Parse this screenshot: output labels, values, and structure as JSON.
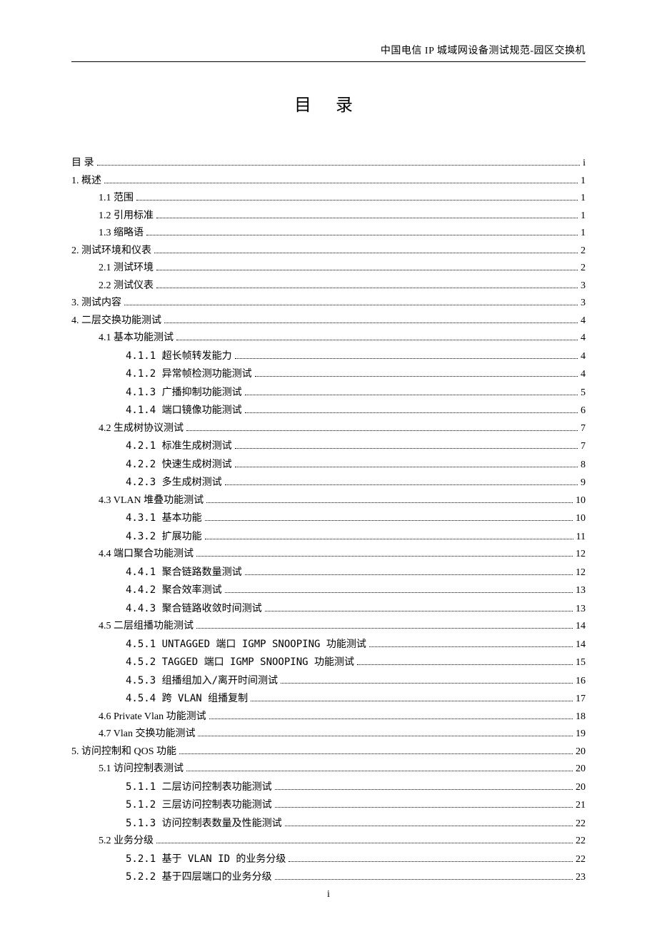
{
  "header": "中国电信 IP 城域网设备测试规范-园区交换机",
  "title": "目  录",
  "footer_page": "i",
  "toc": [
    {
      "level": 0,
      "label": "目   录",
      "page": "i"
    },
    {
      "level": 0,
      "label": "1. 概述",
      "page": "1"
    },
    {
      "level": 1,
      "label": "1.1 范围",
      "page": "1"
    },
    {
      "level": 1,
      "label": "1.2 引用标准",
      "page": "1"
    },
    {
      "level": 1,
      "label": "1.3 缩略语",
      "page": "1"
    },
    {
      "level": 0,
      "label": "2. 测试环境和仪表",
      "page": "2"
    },
    {
      "level": 1,
      "label": "2.1 测试环境",
      "page": "2"
    },
    {
      "level": 1,
      "label": "2.2 测试仪表",
      "page": "3"
    },
    {
      "level": 0,
      "label": "3. 测试内容",
      "page": "3"
    },
    {
      "level": 0,
      "label": "4. 二层交换功能测试",
      "page": "4"
    },
    {
      "level": 1,
      "label": "4.1 基本功能测试",
      "page": "4"
    },
    {
      "level": 2,
      "label": "4.1.1 超长帧转发能力",
      "page": "4"
    },
    {
      "level": 2,
      "label": "4.1.2 异常帧检测功能测试",
      "page": "4"
    },
    {
      "level": 2,
      "label": "4.1.3 广播抑制功能测试",
      "page": "5"
    },
    {
      "level": 2,
      "label": "4.1.4 端口镜像功能测试",
      "page": "6"
    },
    {
      "level": 1,
      "label": "4.2 生成树协议测试",
      "page": "7"
    },
    {
      "level": 2,
      "label": "4.2.1 标准生成树测试",
      "page": "7"
    },
    {
      "level": 2,
      "label": "4.2.2 快速生成树测试",
      "page": "8"
    },
    {
      "level": 2,
      "label": "4.2.3 多生成树测试",
      "page": "9"
    },
    {
      "level": 1,
      "label": "4.3 VLAN 堆叠功能测试",
      "page": "10"
    },
    {
      "level": 2,
      "label": "4.3.1 基本功能",
      "page": "10"
    },
    {
      "level": 2,
      "label": "4.3.2 扩展功能",
      "page": "11"
    },
    {
      "level": 1,
      "label": "4.4 端口聚合功能测试",
      "page": "12"
    },
    {
      "level": 2,
      "label": "4.4.1 聚合链路数量测试",
      "page": "12"
    },
    {
      "level": 2,
      "label": "4.4.2 聚合效率测试",
      "page": "13"
    },
    {
      "level": 2,
      "label": "4.4.3 聚合链路收敛时间测试",
      "page": "13"
    },
    {
      "level": 1,
      "label": "4.5 二层组播功能测试",
      "page": "14"
    },
    {
      "level": 2,
      "label": "4.5.1 UNTAGGED 端口 IGMP SNOOPING 功能测试",
      "page": "14"
    },
    {
      "level": 2,
      "label": "4.5.2 TAGGED 端口 IGMP SNOOPING 功能测试",
      "page": "15"
    },
    {
      "level": 2,
      "label": "4.5.3 组播组加入/离开时间测试",
      "page": "16"
    },
    {
      "level": 2,
      "label": "4.5.4 跨 VLAN 组播复制",
      "page": "17"
    },
    {
      "level": 1,
      "label": "4.6 Private Vlan 功能测试",
      "page": "18"
    },
    {
      "level": 1,
      "label": "4.7 Vlan 交换功能测试",
      "page": "19"
    },
    {
      "level": 0,
      "label": "5. 访问控制和 QOS 功能",
      "page": "20"
    },
    {
      "level": 1,
      "label": "5.1 访问控制表测试",
      "page": "20"
    },
    {
      "level": 2,
      "label": "5.1.1 二层访问控制表功能测试",
      "page": "20"
    },
    {
      "level": 2,
      "label": "5.1.2 三层访问控制表功能测试",
      "page": "21"
    },
    {
      "level": 2,
      "label": "5.1.3 访问控制表数量及性能测试",
      "page": "22"
    },
    {
      "level": 1,
      "label": "5.2 业务分级",
      "page": "22"
    },
    {
      "level": 2,
      "label": "5.2.1 基于 VLAN ID 的业务分级",
      "page": "22"
    },
    {
      "level": 2,
      "label": "5.2.2 基于四层端口的业务分级",
      "page": "23"
    }
  ]
}
